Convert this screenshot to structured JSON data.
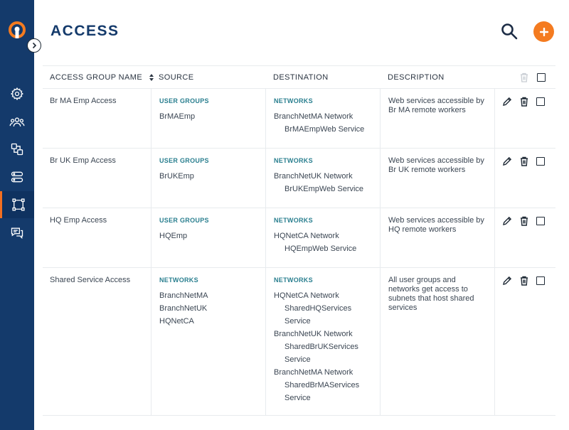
{
  "page": {
    "title": "ACCESS"
  },
  "colors": {
    "sidebar": "#143a6b",
    "accent": "#f47b20",
    "tag": "#2a7f8f"
  },
  "sidebar": {
    "items": [
      {
        "icon": "gear-icon",
        "active": false
      },
      {
        "icon": "users-icon",
        "active": false
      },
      {
        "icon": "network-objects-icon",
        "active": false
      },
      {
        "icon": "servers-icon",
        "active": false
      },
      {
        "icon": "access-icon",
        "active": true
      },
      {
        "icon": "messages-icon",
        "active": false
      }
    ]
  },
  "table": {
    "headers": {
      "group_name": "ACCESS GROUP NAME",
      "source": "SOURCE",
      "destination": "DESTINATION",
      "description": "DESCRIPTION"
    },
    "rows": [
      {
        "name": "Br MA Emp Access",
        "source_tag": "USER GROUPS",
        "source_items": [
          "BrMAEmp"
        ],
        "dest_tag": "NETWORKS",
        "dest_lines": [
          {
            "text": "BranchNetMA Network",
            "indent": false
          },
          {
            "text": "BrMAEmpWeb Service",
            "indent": true
          }
        ],
        "description": "Web services accessible by Br MA remote workers"
      },
      {
        "name": "Br UK Emp Access",
        "source_tag": "USER GROUPS",
        "source_items": [
          "BrUKEmp"
        ],
        "dest_tag": "NETWORKS",
        "dest_lines": [
          {
            "text": "BranchNetUK Network",
            "indent": false
          },
          {
            "text": "BrUKEmpWeb Service",
            "indent": true
          }
        ],
        "description": "Web services accessible by Br UK remote workers"
      },
      {
        "name": "HQ Emp Access",
        "source_tag": "USER GROUPS",
        "source_items": [
          "HQEmp"
        ],
        "dest_tag": "NETWORKS",
        "dest_lines": [
          {
            "text": "HQNetCA Network",
            "indent": false
          },
          {
            "text": "HQEmpWeb Service",
            "indent": true
          }
        ],
        "description": "Web services accessible by HQ remote workers"
      },
      {
        "name": "Shared Service Access",
        "source_tag": "NETWORKS",
        "source_items": [
          "BranchNetMA",
          "BranchNetUK",
          "HQNetCA"
        ],
        "dest_tag": "NETWORKS",
        "dest_lines": [
          {
            "text": "HQNetCA Network",
            "indent": false
          },
          {
            "text": "SharedHQServices",
            "indent": true
          },
          {
            "text": "Service",
            "indent": true
          },
          {
            "text": "BranchNetUK Network",
            "indent": false
          },
          {
            "text": "SharedBrUKServices",
            "indent": true
          },
          {
            "text": "Service",
            "indent": true
          },
          {
            "text": "BranchNetMA Network",
            "indent": false
          },
          {
            "text": "SharedBrMAServices",
            "indent": true
          },
          {
            "text": "Service",
            "indent": true
          }
        ],
        "description": "All user groups and networks get access to subnets that host shared services"
      }
    ]
  }
}
